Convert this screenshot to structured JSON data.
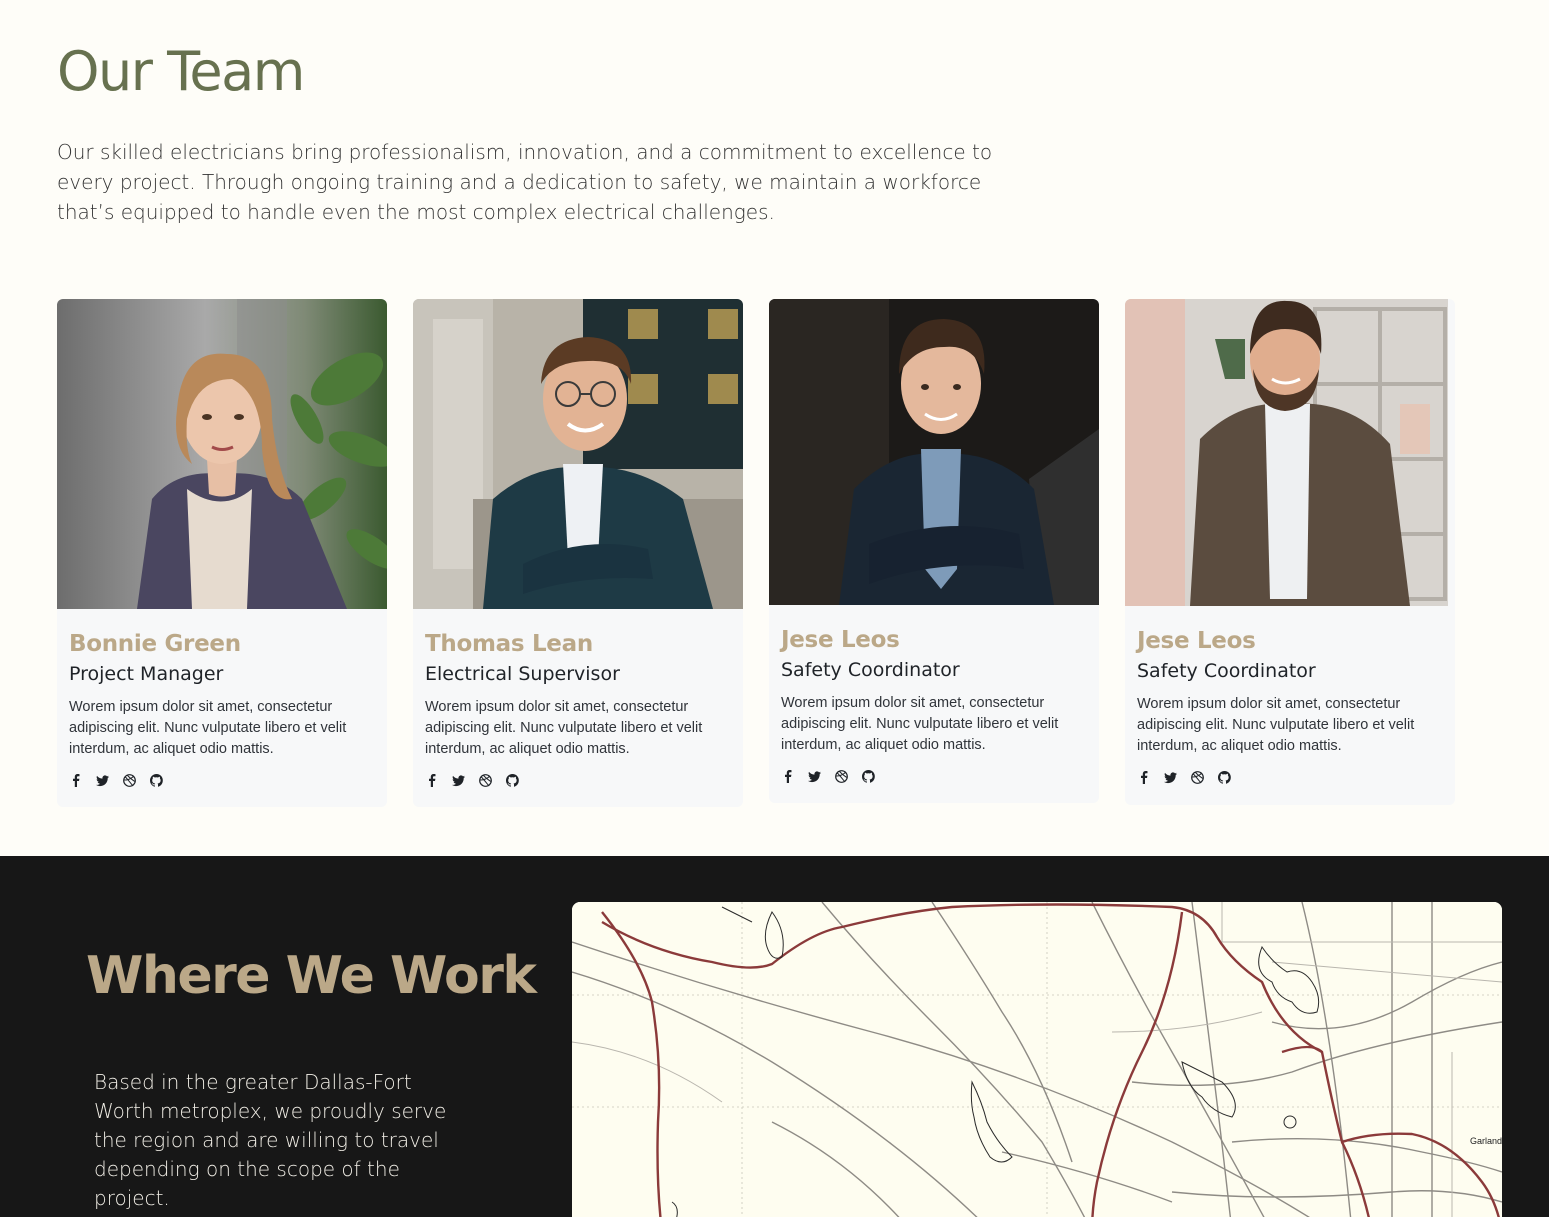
{
  "team": {
    "title": "Our Team",
    "intro": "Our skilled electricians bring professionalism, innovation, and a commitment to excellence to every project. Through ongoing training and a dedication to safety, we maintain a workforce that’s equipped to handle even the most complex electrical challenges.",
    "members": [
      {
        "name": "Bonnie Green",
        "role": "Project Manager",
        "bio": "Worem ipsum dolor sit amet, consectetur adipiscing elit. Nunc vulputate libero et velit interdum, ac aliquet odio mattis."
      },
      {
        "name": "Thomas Lean",
        "role": "Electrical Supervisor",
        "bio": "Worem ipsum dolor sit amet, consectetur adipiscing elit. Nunc vulputate libero et velit interdum, ac aliquet odio mattis."
      },
      {
        "name": "Jese Leos",
        "role": "Safety Coordinator",
        "bio": "Worem ipsum dolor sit amet, consectetur adipiscing elit. Nunc vulputate libero et velit interdum, ac aliquet odio mattis."
      },
      {
        "name": "Jese Leos",
        "role": "Safety Coordinator",
        "bio": "Worem ipsum dolor sit amet, consectetur adipiscing elit. Nunc vulputate libero et velit interdum, ac aliquet odio mattis."
      }
    ],
    "social_icons": [
      "facebook-icon",
      "twitter-icon",
      "dribbble-icon",
      "github-icon"
    ]
  },
  "work": {
    "title": "Where We Work",
    "text": "Based in the greater Dallas-Fort Worth metroplex, we proudly serve the region and are willing to travel depending on the scope of the project.",
    "map_label": "Garland"
  },
  "colors": {
    "page_bg": "#fefdf8",
    "team_title": "#67714f",
    "accent": "#bba888",
    "dark_bg": "#171717",
    "map_highway": "#8b3a3a"
  }
}
